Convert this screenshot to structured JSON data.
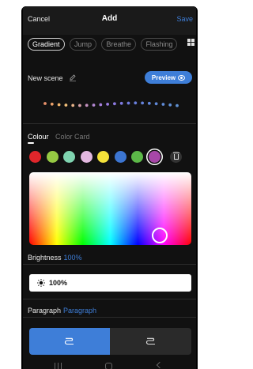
{
  "header": {
    "cancel_label": "Cancel",
    "title": "Add",
    "save_label": "Save"
  },
  "modes": [
    {
      "label": "Gradient",
      "active": true
    },
    {
      "label": "Jump",
      "active": false
    },
    {
      "label": "Breathe",
      "active": false
    },
    {
      "label": "Flashing",
      "active": false
    }
  ],
  "scene": {
    "name": "New scene",
    "preview_label": "Preview",
    "preview_dot_colors": [
      "#e8916b",
      "#eba06a",
      "#f0b46d",
      "#f3c07a",
      "#e8b48a",
      "#d7a1a8",
      "#c592c0",
      "#b387d2",
      "#a77fdc",
      "#9a7be0",
      "#8d7ae2",
      "#7f7be2",
      "#727de0",
      "#6a80de",
      "#6683dc",
      "#6286da",
      "#6189d8",
      "#608bd6",
      "#608ed4",
      "#6091d2"
    ]
  },
  "colour_tabs": {
    "colour": "Colour",
    "color_card": "Color Card"
  },
  "swatches": [
    "#e0262b",
    "#96c943",
    "#7fd4b0",
    "#e3b8e0",
    "#f4e23a",
    "#3c75d1",
    "#5cb848",
    "#a747a8"
  ],
  "selected_swatch_index": 7,
  "brightness": {
    "label": "Brightness",
    "value": "100%",
    "bar_text": "100%"
  },
  "paragraph": {
    "label": "Paragraph",
    "value": "Paragraph"
  },
  "colors": {
    "accent": "#3e7ed8",
    "background": "#111111"
  }
}
